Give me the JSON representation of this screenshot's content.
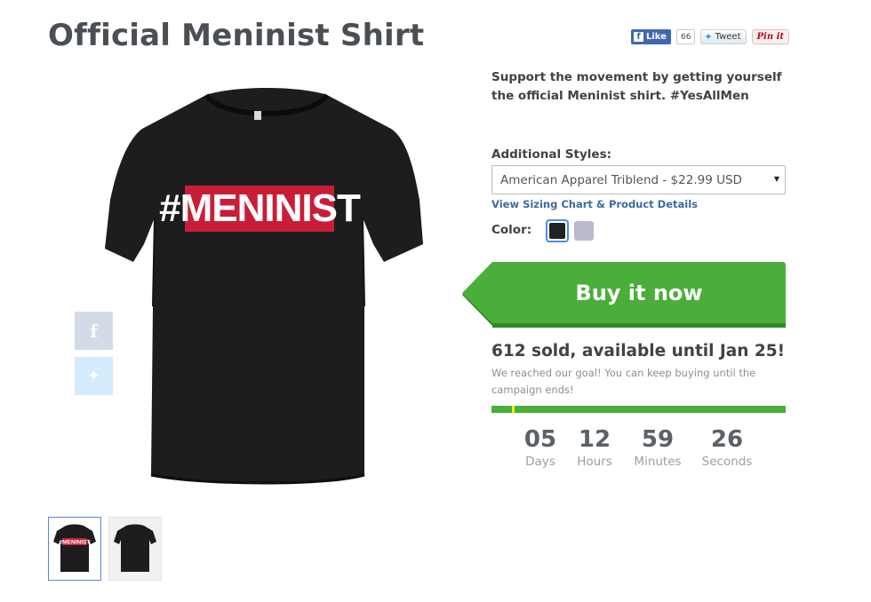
{
  "product": {
    "title": "Official Meninist Shirt",
    "description": "Support the movement by getting yourself the official Meninist shirt. #YesAllMen",
    "shirt_print": "#MENINIST"
  },
  "social": {
    "like_label": "Like",
    "like_count": "66",
    "tweet_label": "Tweet",
    "pin_label": "Pin it"
  },
  "styles": {
    "label": "Additional Styles:",
    "selected": "American Apparel Triblend - $22.99 USD",
    "sizing_link": "View Sizing Chart & Product Details"
  },
  "color": {
    "label": "Color:",
    "options": [
      "#222222",
      "#b9bbcc"
    ],
    "selected_index": 0
  },
  "buy": {
    "label": "Buy it now",
    "color": "#4cae3a"
  },
  "campaign": {
    "sold_text": "612 sold, available until Jan 25!",
    "goal_text": "We reached our goal! You can keep buying until the campaign ends!",
    "goal_marker_fraction": 0.07
  },
  "countdown": {
    "days": "05",
    "days_label": "Days",
    "hours": "12",
    "hours_label": "Hours",
    "minutes": "59",
    "minutes_label": "Minutes",
    "seconds": "26",
    "seconds_label": "Seconds"
  },
  "thumbnails": [
    {
      "name": "front",
      "print": "#MENINIST"
    },
    {
      "name": "back"
    }
  ]
}
